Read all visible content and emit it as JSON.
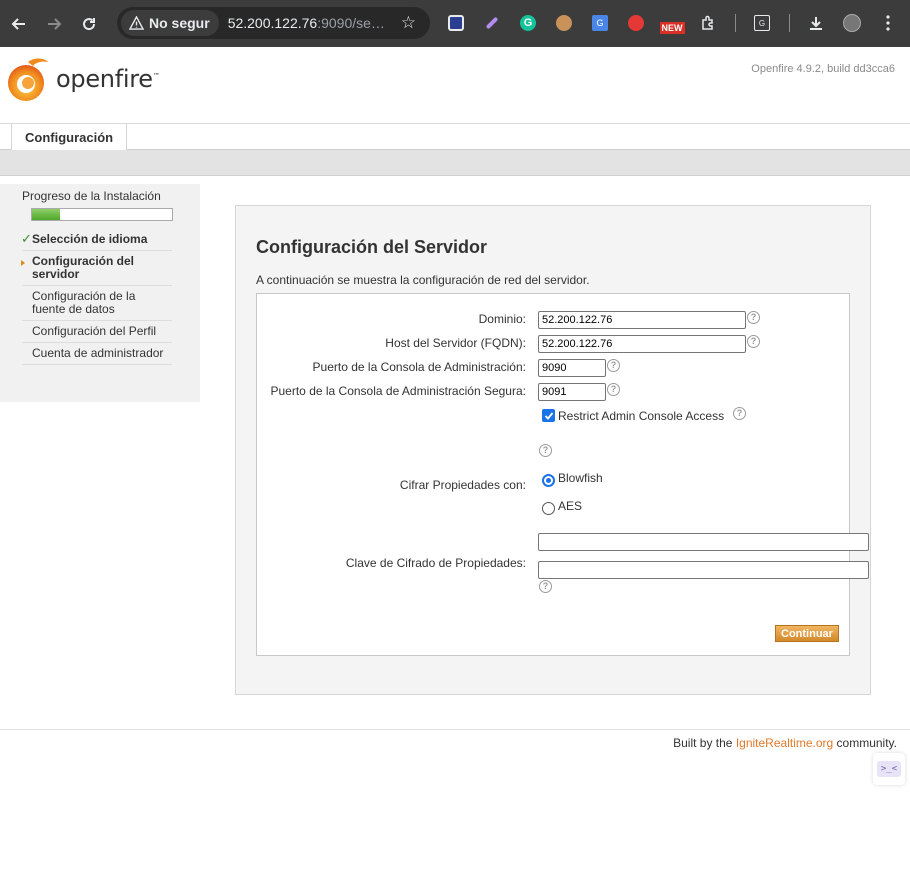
{
  "browser": {
    "security_label": "No segur",
    "url_host": "52.200.122.76",
    "url_rest": ":9090/se…"
  },
  "header": {
    "logo_text": "openfire",
    "logo_tm": "™",
    "version": "Openfire 4.9.2, build dd3cca6"
  },
  "tabs": {
    "config_label": "Configuración"
  },
  "sidebar": {
    "title": "Progreso de la Instalación",
    "progress_fraction": 0.2,
    "steps": [
      {
        "label": "Selección de idioma"
      },
      {
        "label": "Configuración del servidor"
      },
      {
        "label": "Configuración de la fuente de datos"
      },
      {
        "label": "Configuración del Perfil"
      },
      {
        "label": "Cuenta de administrador"
      }
    ]
  },
  "main": {
    "title": "Configuración del Servidor",
    "description": "A continuación se muestra la configuración de red del servidor.",
    "domain_label": "Dominio:",
    "domain_value": "52.200.122.76",
    "fqdn_label": "Host del Servidor (FQDN):",
    "fqdn_value": "52.200.122.76",
    "admin_port_label": "Puerto de la Consola de Administración:",
    "admin_port_value": "9090",
    "secure_port_label": "Puerto de la Consola de Administración Segura:",
    "secure_port_value": "9091",
    "restrict_label": "Restrict Admin Console Access",
    "encrypt_label": "Cifrar Propiedades con:",
    "option_blowfish": "Blowfish",
    "option_aes": "AES",
    "key_label": "Clave de Cifrado de Propiedades:",
    "help_glyph": "?",
    "continue_label": "Continuar"
  },
  "footer": {
    "prefix": "Built by the ",
    "link": "IgniteRealtime.org",
    "suffix": " community."
  },
  "float_widget": {
    "text": ">_<"
  },
  "colors": {
    "accent": "#e0782a",
    "progress": "#4ea72a",
    "button": "#d2892a"
  }
}
